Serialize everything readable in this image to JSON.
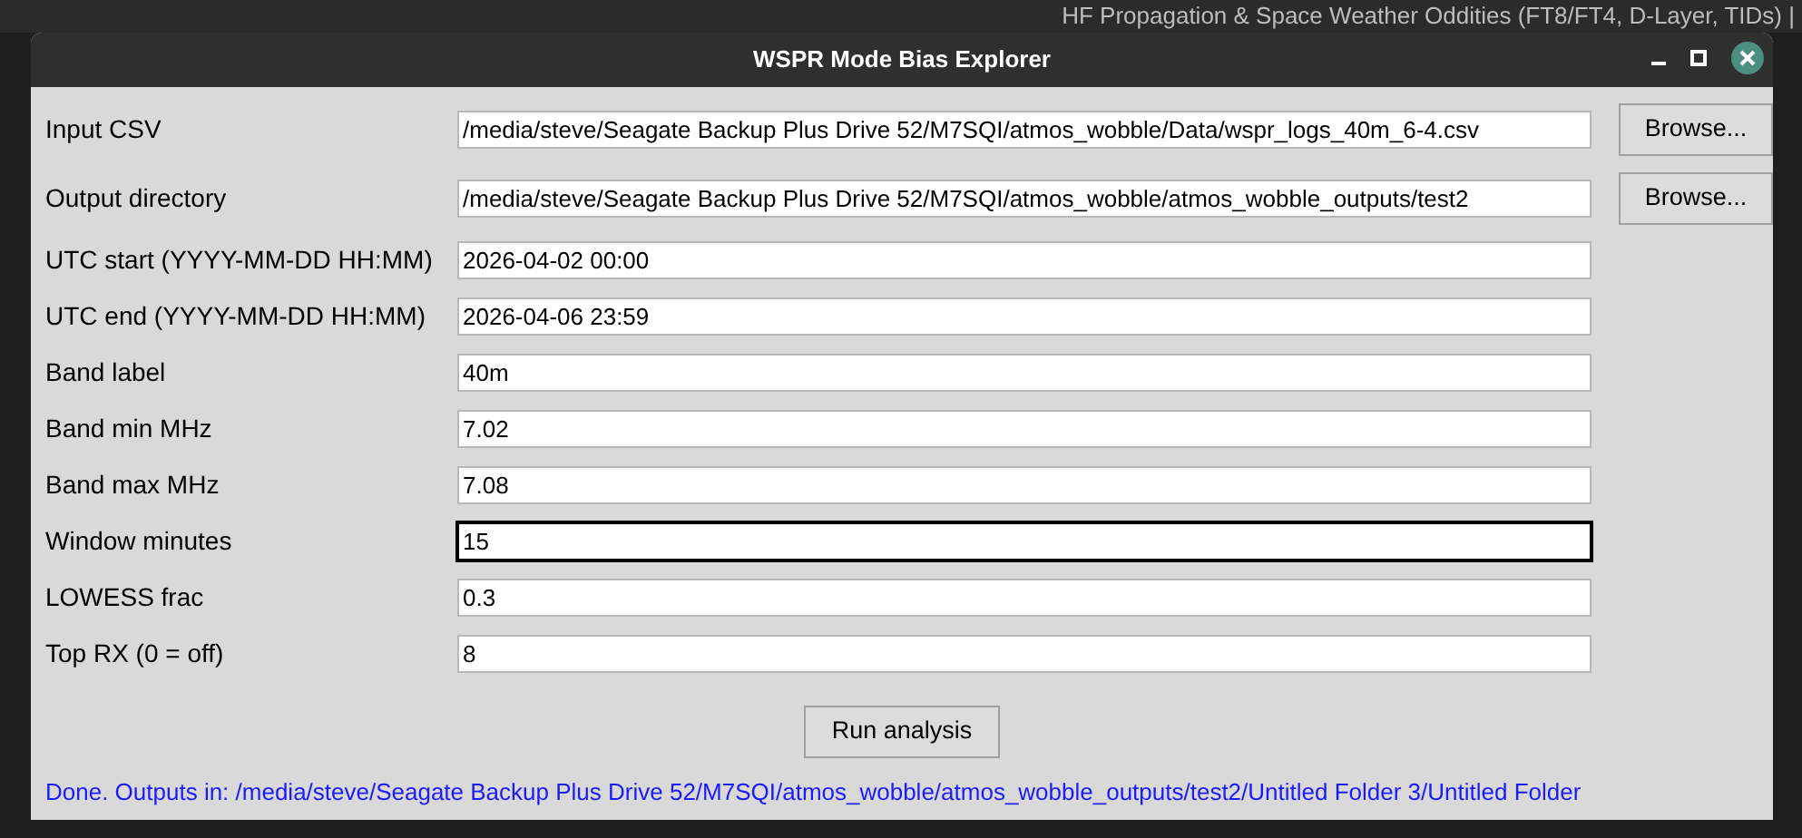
{
  "background_title": "HF Propagation & Space Weather Oddities (FT8/FT4, D-Layer, TIDs) |",
  "window": {
    "title": "WSPR Mode Bias Explorer"
  },
  "fields": [
    {
      "label": "Input CSV",
      "value": "/media/steve/Seagate Backup Plus Drive 52/M7SQI/atmos_wobble/Data/wspr_logs_40m_6-4.csv",
      "focused": false,
      "button": "Browse..."
    },
    {
      "label": "Output directory",
      "value": "/media/steve/Seagate Backup Plus Drive 52/M7SQI/atmos_wobble/atmos_wobble_outputs/test2",
      "focused": false,
      "button": "Browse..."
    },
    {
      "label": "UTC start (YYYY-MM-DD HH:MM)",
      "value": "2026-04-02 00:00",
      "focused": false
    },
    {
      "label": "UTC end (YYYY-MM-DD HH:MM)",
      "value": "2026-04-06 23:59",
      "focused": false
    },
    {
      "label": "Band label",
      "value": "40m",
      "focused": false
    },
    {
      "label": "Band min MHz",
      "value": "7.02",
      "focused": false
    },
    {
      "label": "Band max MHz",
      "value": "7.08",
      "focused": false
    },
    {
      "label": "Window minutes",
      "value": "15",
      "focused": true
    },
    {
      "label": "LOWESS frac",
      "value": "0.3",
      "focused": false
    },
    {
      "label": "Top RX (0 = off)",
      "value": "8",
      "focused": false
    }
  ],
  "run_button": "Run analysis",
  "status": "Done. Outputs in: /media/steve/Seagate Backup Plus Drive 52/M7SQI/atmos_wobble/atmos_wobble_outputs/test2/Untitled Folder 3/Untitled Folder"
}
